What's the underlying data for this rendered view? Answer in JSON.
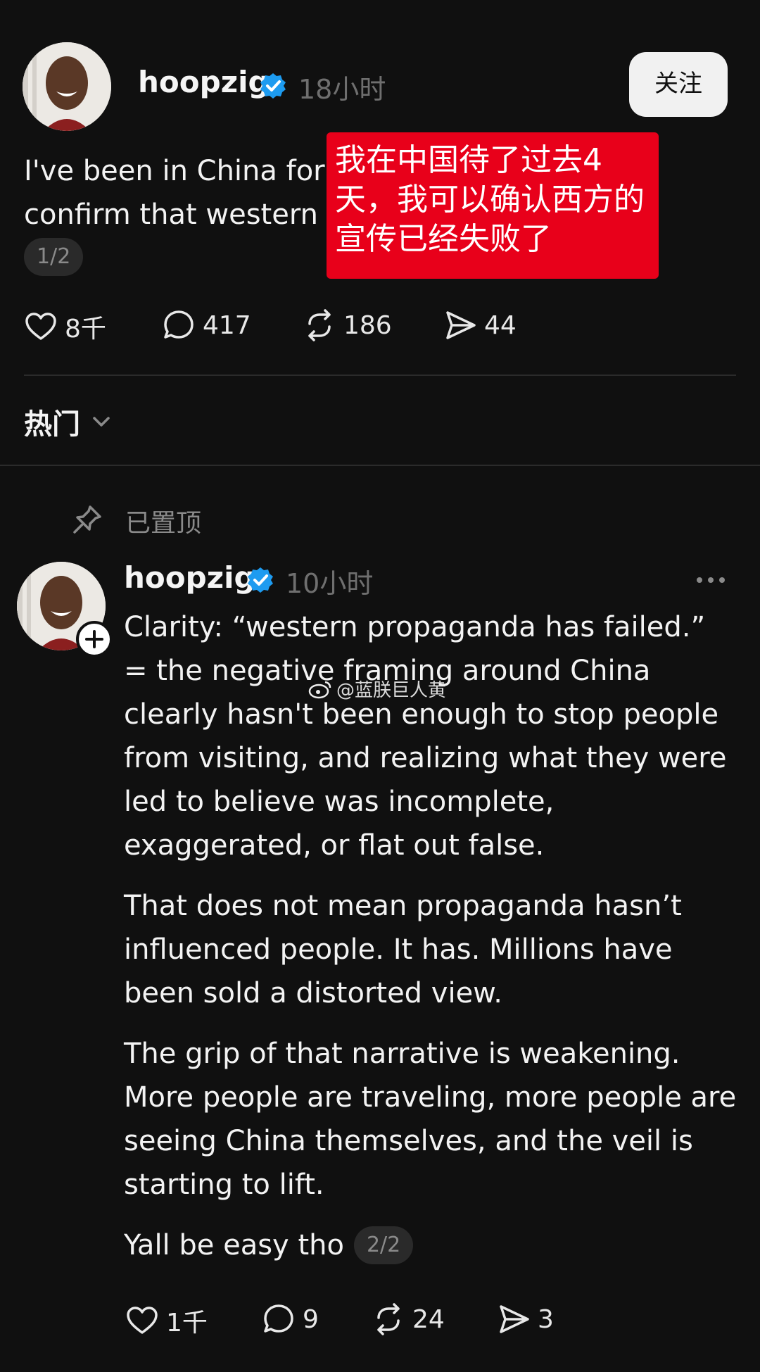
{
  "post": {
    "username": "hoopzig",
    "time": "18小时",
    "follow_label": "关注",
    "text_line1": "I've been in China for t",
    "text_line2": "confirm that western p",
    "page_indicator": "1/2",
    "overlay_text": "我在中国待了过去4天，我可以确认西方的宣传已经失败了",
    "stats": {
      "likes": "8千",
      "replies": "417",
      "reposts": "186",
      "shares": "44"
    }
  },
  "sort": {
    "label": "热门"
  },
  "reply": {
    "pinned_label": "已置顶",
    "username": "hoopzig",
    "time": "10小时",
    "watermark": "@蓝朕巨人黄",
    "paragraphs": [
      "Clarity: “western propaganda has failed.” = the negative framing around China clearly hasn't been enough to stop people from visiting, and realizing  what they were led to believe was incomplete, exaggerated, or flat out false.",
      "That does not mean propaganda hasn’t influenced people. It has. Millions have been sold a distorted view.",
      "The grip of that narrative is weakening. More people are traveling, more people are seeing China themselves, and the veil is starting to lift."
    ],
    "last_line": "Yall be easy tho",
    "page_indicator": "2/2",
    "stats": {
      "likes": "1千",
      "replies": "9",
      "reposts": "24",
      "shares": "3"
    }
  },
  "colors": {
    "background": "#101010",
    "overlay_red": "#e8001a",
    "verified_blue": "#1d9bf0",
    "muted": "#6f6f6f"
  },
  "icons": [
    "verified-badge-icon",
    "heart-icon",
    "comment-icon",
    "repost-icon",
    "share-icon",
    "chevron-down-icon",
    "pin-icon",
    "more-icon",
    "plus-icon",
    "weibo-icon"
  ]
}
